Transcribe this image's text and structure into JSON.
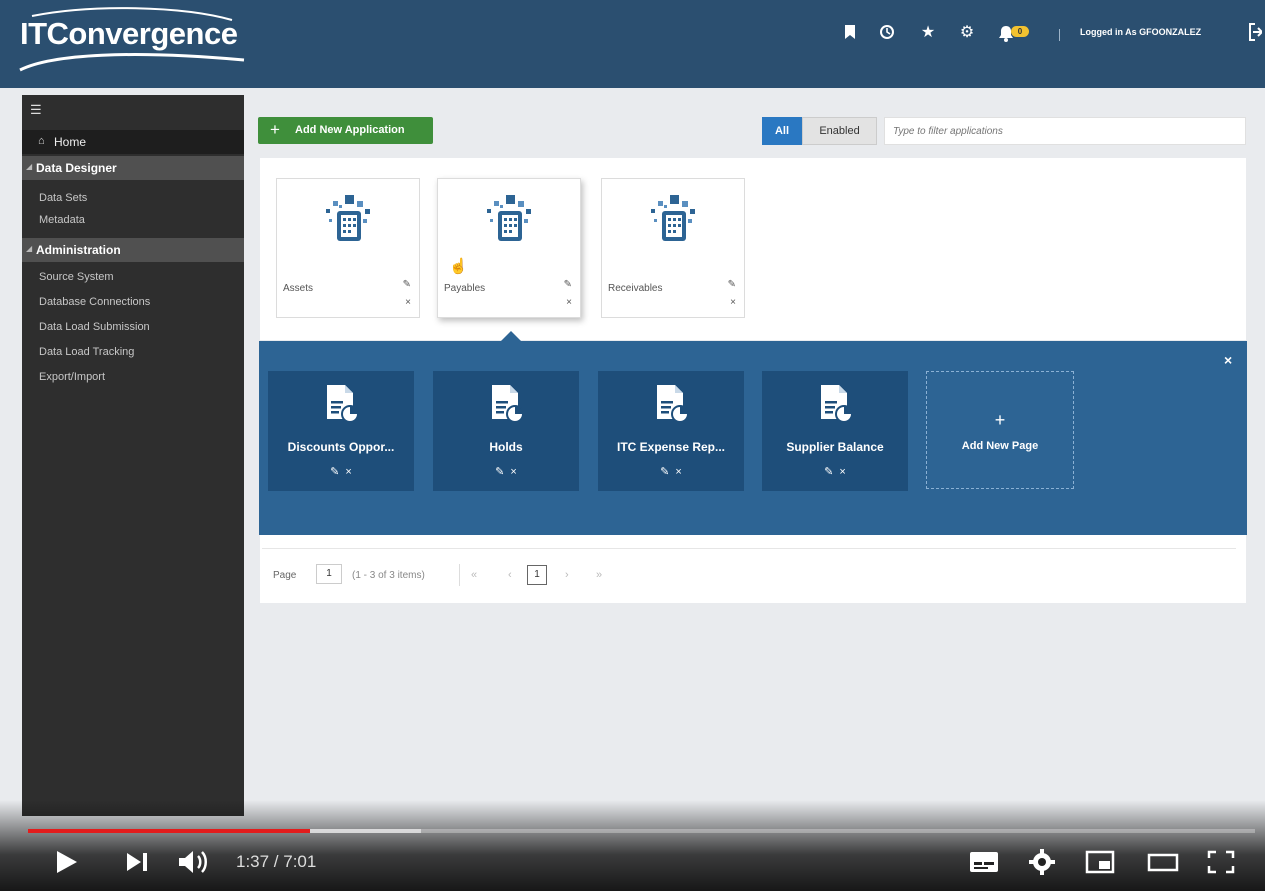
{
  "header": {
    "logo_text": "ITConvergence",
    "icons": [
      "bookmark-icon",
      "history-icon",
      "star-icon",
      "gear-icon",
      "notifications-icon",
      "logout-icon"
    ],
    "notification_count": "0",
    "user_label": "Logged in As GFOONZALEZ"
  },
  "sidebar": {
    "menu_icon": "hamburger-icon",
    "home_label": "Home",
    "sections": [
      {
        "label": "Data Designer",
        "items": [
          "Data Sets",
          "Metadata"
        ]
      },
      {
        "label": "Administration",
        "items": [
          "Source System",
          "Database Connections",
          "Data Load Submission",
          "Data Load Tracking",
          "Export/Import"
        ]
      }
    ]
  },
  "toolbar": {
    "add_button_label": "Add New Application",
    "filter_all_label": "All",
    "filter_enabled_label": "Enabled",
    "filter_placeholder": "Type to filter applications"
  },
  "applications": [
    {
      "name": "Assets",
      "edit_icon": "✎",
      "delete_icon": "×"
    },
    {
      "name": "Payables",
      "edit_icon": "✎",
      "delete_icon": "×"
    },
    {
      "name": "Receivables",
      "edit_icon": "✎",
      "delete_icon": "×"
    }
  ],
  "pages": {
    "close_icon": "×",
    "tiles": [
      {
        "title": "Discounts Oppor...",
        "edit_icon": "✎",
        "delete_icon": "×"
      },
      {
        "title": "Holds",
        "edit_icon": "✎",
        "delete_icon": "×"
      },
      {
        "title": "ITC Expense Rep...",
        "edit_icon": "✎",
        "delete_icon": "×"
      },
      {
        "title": "Supplier Balance",
        "edit_icon": "✎",
        "delete_icon": "×"
      }
    ],
    "add_page_plus": "+",
    "add_page_label": "Add New Page"
  },
  "pager": {
    "label": "Page",
    "page_value": "1",
    "range_text": "(1 - 3 of 3 items)",
    "first": "«",
    "prev": "‹",
    "current": "1",
    "next": "›",
    "last": "»"
  },
  "video": {
    "time": "1:37 / 7:01",
    "progress_played": 0.23,
    "progress_buffered": 0.32,
    "controls": [
      "play-icon",
      "next-icon",
      "volume-icon",
      "subtitles-icon",
      "settings-icon",
      "miniplayer-icon",
      "theater-icon",
      "fullscreen-icon"
    ]
  },
  "colors": {
    "header": "#2b4f70",
    "sidebar": "#2e2e2e",
    "add_button": "#3f8f3b",
    "pages_panel": "#2d6494",
    "page_tile": "#1e4e7a",
    "progress": "#e31c1c"
  }
}
